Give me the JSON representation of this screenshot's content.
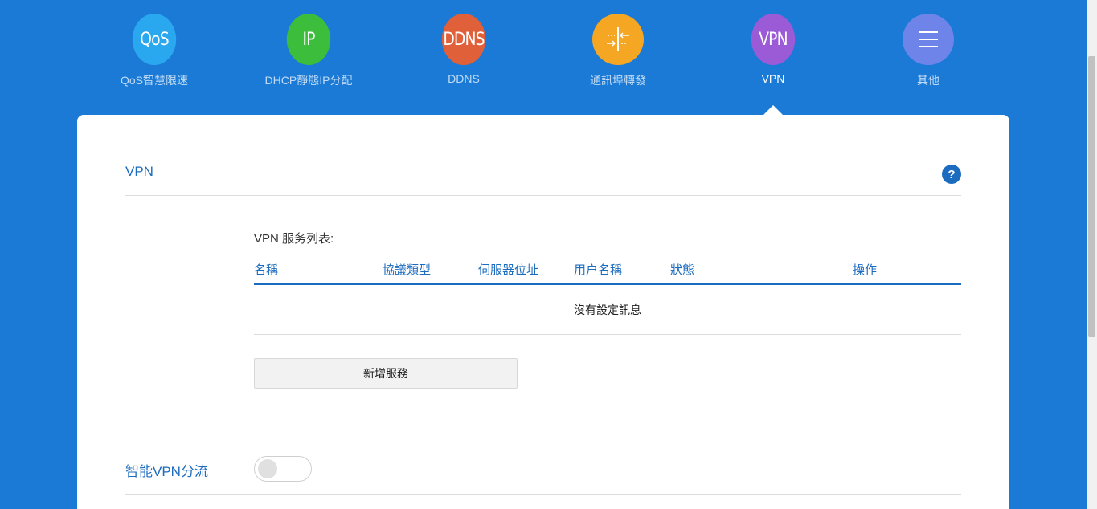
{
  "nav": {
    "items": [
      {
        "icon_text": "QoS",
        "label": "QoS智慧限速",
        "color": "#2aa8ef"
      },
      {
        "icon_text": "IP",
        "label": "DHCP靜態IP分配",
        "color": "#3dbd3c"
      },
      {
        "icon_text": "DDNS",
        "label": "DDNS",
        "color": "#e0603a"
      },
      {
        "icon_text": "",
        "label": "通訊埠轉發",
        "color": "#f5a623",
        "icon": "port-forward-icon"
      },
      {
        "icon_text": "VPN",
        "label": "VPN",
        "color": "#9b5ad6"
      },
      {
        "icon_text": "",
        "label": "其他",
        "color": "#6f84e8",
        "icon": "menu-icon"
      }
    ],
    "active_index": 4
  },
  "section": {
    "title": "VPN",
    "help_icon": "?"
  },
  "vpn_list": {
    "title": "VPN 服务列表:",
    "columns": [
      "名稱",
      "協議類型",
      "伺服器位址",
      "用户名稱",
      "狀態",
      "操作"
    ],
    "empty_message": "沒有設定訊息",
    "add_button": "新增服務"
  },
  "smart_split": {
    "label": "智能VPN分流",
    "enabled": false
  },
  "colors": {
    "background": "#1a7ad6",
    "accent": "#1b6bbf"
  }
}
